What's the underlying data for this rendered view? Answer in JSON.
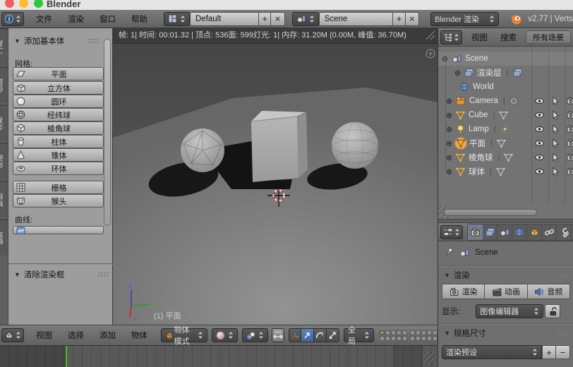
{
  "titlebar": {
    "app_title": "Blender"
  },
  "top_header": {
    "menus": [
      "文件",
      "渲染",
      "窗口",
      "帮助"
    ],
    "layout_value": "Default",
    "scene_value": "Scene",
    "engine_value": "Blender 渲染",
    "version": "v2.77 | Verts",
    "add_label": "+",
    "close_label": "×"
  },
  "tool_shelf": {
    "tabs": [
      "工具",
      "创建",
      "关系",
      "动画",
      "物理",
      "蜡笔"
    ],
    "panel_add_title": "添加基本体",
    "mesh_label": "网格:",
    "mesh_buttons": [
      "平面",
      "立方体",
      "圆环",
      "经纬球",
      "棱角球",
      "柱体",
      "锥体",
      "环体"
    ],
    "extra_buttons": [
      "栅格",
      "猴头"
    ],
    "curve_label": "曲线:",
    "panel_clear_title": "清除渲染框"
  },
  "viewport": {
    "stats": "帧: 1| 时间: 00:01.32 | 顶点: 536面: 599灯光: 1| 内存: 31.20M (0.00M, 峰值: 36.70M)",
    "active_object": "(1) 平面",
    "axis_labels": {
      "x": "x",
      "y": "y",
      "z": "z"
    }
  },
  "viewport_header": {
    "menus": [
      "视图",
      "选择",
      "添加",
      "物体"
    ],
    "mode_value": "物体模式",
    "orientation_value": "全局"
  },
  "outliner": {
    "menus": [
      "视图",
      "搜索"
    ],
    "display_mode": "所有场景",
    "rows": [
      {
        "label": "Scene"
      },
      {
        "label": "渲染层"
      },
      {
        "label": "World"
      },
      {
        "label": "Camera"
      },
      {
        "label": "Cube"
      },
      {
        "label": "Lamp"
      },
      {
        "label": "平面"
      },
      {
        "label": "棱角球"
      },
      {
        "label": "球体"
      }
    ],
    "pipe": "|",
    "expand_open": "⊖",
    "expand_closed": "⊕"
  },
  "properties": {
    "breadcrumb_scene": "Scene",
    "render_panel_title": "渲染",
    "render_buttons": [
      "渲染",
      "动画",
      "音频"
    ],
    "display_label": "显示:",
    "display_value": "图像编辑器",
    "dimensions_panel_title": "规格尺寸",
    "preset_value": "渲染预设",
    "plus": "+",
    "minus": "−"
  },
  "colors": {
    "accent_orange": "#e8933a",
    "selection_blue": "#4f74b8",
    "playhead_green": "#56b23c",
    "axis_x_red": "#b83535",
    "axis_y_green": "#2f9e2f",
    "axis_z_blue": "#4242d8",
    "mac_red": "#f25f57",
    "mac_yellow": "#fcbc2e",
    "mac_green": "#2bc840"
  }
}
